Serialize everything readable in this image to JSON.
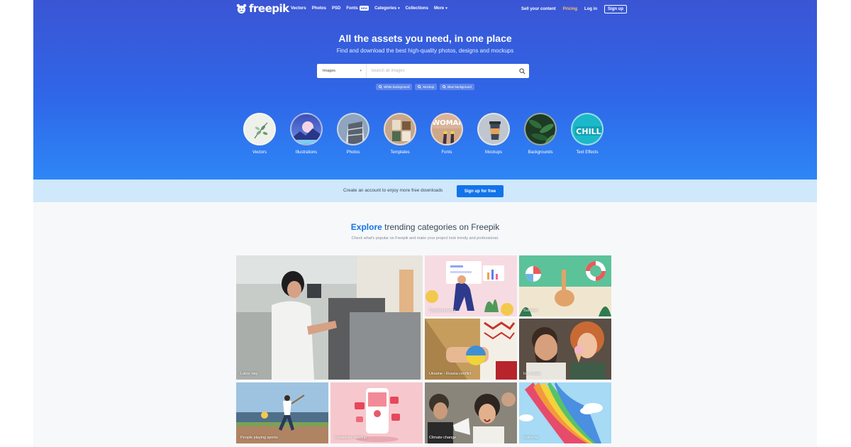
{
  "brand": {
    "name": "freepik"
  },
  "nav": {
    "items": [
      {
        "label": "Vectors"
      },
      {
        "label": "Photos"
      },
      {
        "label": "PSD"
      },
      {
        "label": "Fonts",
        "badge": "NEW"
      },
      {
        "label": "Categories",
        "dropdown": true
      },
      {
        "label": "Collections"
      },
      {
        "label": "More",
        "dropdown": true
      }
    ],
    "sell": "Sell your content",
    "pricing": "Pricing",
    "login": "Log in",
    "signup": "Sign up"
  },
  "hero": {
    "title": "All the assets you need, in one place",
    "subtitle": "Find and download the best high-quality photos, designs and mockups"
  },
  "search": {
    "type": "Images",
    "placeholder": "Search all images",
    "icon": "search-icon"
  },
  "suggestions": [
    "White background",
    "Mockup",
    "Blue background"
  ],
  "categories": [
    {
      "label": "Vectors"
    },
    {
      "label": "Illustrations"
    },
    {
      "label": "Photos"
    },
    {
      "label": "Templates"
    },
    {
      "label": "Fonts"
    },
    {
      "label": "Mockups"
    },
    {
      "label": "Backgrounds"
    },
    {
      "label": "Text Effects"
    }
  ],
  "banner": {
    "text": "Create an account to enjoy more free downloads",
    "button": "Sign up for free"
  },
  "explore": {
    "title_accent": "Explore",
    "title_rest": " trending categories on Freepik",
    "subtitle": "Check what's popular on Freepik and make your project look trendy and professional."
  },
  "tiles": [
    {
      "label": "Labor day"
    },
    {
      "label": "Cryptocurrency"
    },
    {
      "label": "Summer"
    },
    {
      "label": "Ukraine - Russia conflict"
    },
    {
      "label": "Ice cream"
    },
    {
      "label": "People playing sports"
    },
    {
      "label": "Instagram mockup"
    },
    {
      "label": "Climate change"
    },
    {
      "label": "Rainbow"
    }
  ],
  "colors": {
    "hero_top": "#3a55d4",
    "hero_bottom": "#2e86f6",
    "accent": "#1273eb",
    "pricing": "#ffc56a",
    "banner": "#cfe8fb"
  }
}
